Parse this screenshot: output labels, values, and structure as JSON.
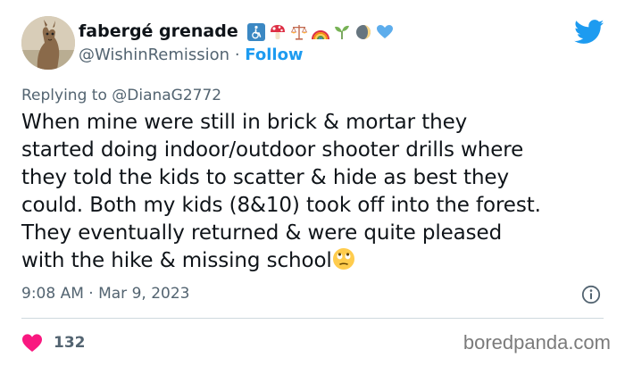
{
  "author": {
    "display_name": "fabergé grenade",
    "handle": "@WishinRemission",
    "separator": "·",
    "follow_label": "Follow",
    "name_emojis": [
      "wheelchair-icon",
      "mushroom-icon",
      "scales-icon",
      "rainbow-icon",
      "seedling-icon",
      "moon-icon",
      "blue-heart-icon"
    ]
  },
  "reply": {
    "prefix": "Replying to",
    "handle": "@DianaG2772"
  },
  "tweet": {
    "lines": [
      "When mine were still in brick & mortar they",
      "started doing indoor/outdoor shooter drills where",
      "they told the kids to scatter & hide as best they",
      "could. Both my kids (8&10) took off into the forest.",
      "They eventually returned & were quite pleased",
      "with the hike & missing school"
    ],
    "trailing_emoji": "rolling-eyes-emoji"
  },
  "meta": {
    "timestamp": "9:08 AM · Mar 9, 2023"
  },
  "engagement": {
    "likes": "132"
  },
  "watermark": "boredpanda.com",
  "colors": {
    "accent": "#1d9bf0",
    "secondary_text": "#536471",
    "like": "#f91880",
    "divider": "#cfd9de"
  }
}
